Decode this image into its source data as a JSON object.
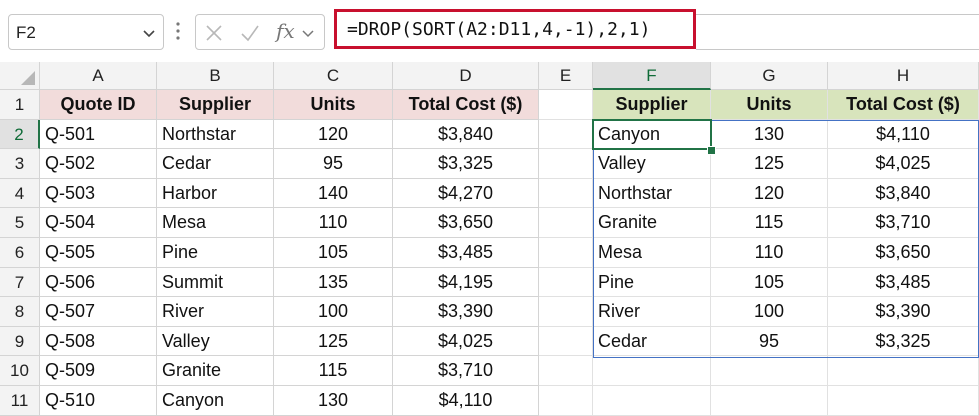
{
  "name_box": {
    "value": "F2"
  },
  "formula_bar": {
    "formula": "=DROP(SORT(A2:D11,4,-1),2,1)",
    "fx_label": "fx",
    "highlight_color": "#c8102e"
  },
  "columns": [
    "A",
    "B",
    "C",
    "D",
    "E",
    "F",
    "G",
    "H"
  ],
  "rows": [
    "1",
    "2",
    "3",
    "4",
    "5",
    "6",
    "7",
    "8",
    "9",
    "10",
    "11"
  ],
  "active_cell": "F2",
  "source_table": {
    "headers": [
      "Quote ID",
      "Supplier",
      "Units",
      "Total Cost ($)"
    ],
    "header_color": "#f2dcdb",
    "rows": [
      [
        "Q-501",
        "Northstar",
        "120",
        "$3,840"
      ],
      [
        "Q-502",
        "Cedar",
        "95",
        "$3,325"
      ],
      [
        "Q-503",
        "Harbor",
        "140",
        "$4,270"
      ],
      [
        "Q-504",
        "Mesa",
        "110",
        "$3,650"
      ],
      [
        "Q-505",
        "Pine",
        "105",
        "$3,485"
      ],
      [
        "Q-506",
        "Summit",
        "135",
        "$4,195"
      ],
      [
        "Q-507",
        "River",
        "100",
        "$3,390"
      ],
      [
        "Q-508",
        "Valley",
        "125",
        "$4,025"
      ],
      [
        "Q-509",
        "Granite",
        "115",
        "$3,710"
      ],
      [
        "Q-510",
        "Canyon",
        "130",
        "$4,110"
      ]
    ]
  },
  "result_table": {
    "headers": [
      "Supplier",
      "Units",
      "Total Cost ($)"
    ],
    "header_color": "#d8e4bc",
    "rows": [
      [
        "Canyon",
        "130",
        "$4,110"
      ],
      [
        "Valley",
        "125",
        "$4,025"
      ],
      [
        "Northstar",
        "120",
        "$3,840"
      ],
      [
        "Granite",
        "115",
        "$3,710"
      ],
      [
        "Mesa",
        "110",
        "$3,650"
      ],
      [
        "Pine",
        "105",
        "$3,485"
      ],
      [
        "River",
        "100",
        "$3,390"
      ],
      [
        "Cedar",
        "95",
        "$3,325"
      ]
    ]
  }
}
